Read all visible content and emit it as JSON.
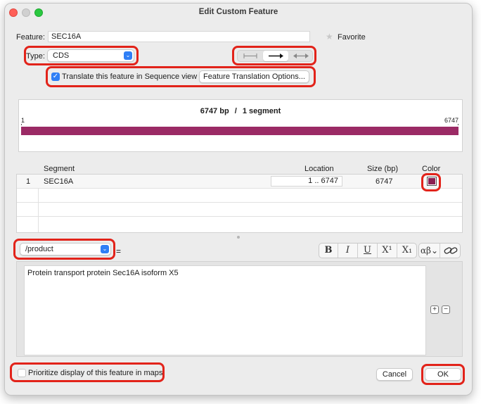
{
  "window": {
    "title": "Edit Custom Feature"
  },
  "feature": {
    "label": "Feature:",
    "name": "SEC16A",
    "favorite_label": "Favorite"
  },
  "type": {
    "label": "Type:",
    "value": "CDS"
  },
  "translate": {
    "checkbox_label": "Translate this feature in Sequence view",
    "checked": true,
    "options_button": "Feature Translation Options..."
  },
  "map": {
    "summary_bp": "6747 bp",
    "summary_sep": "/",
    "summary_seg": "1 segment",
    "start": "1",
    "end": "6747",
    "color": "#9b2a65"
  },
  "segments": {
    "headers": {
      "segment": "Segment",
      "location": "Location",
      "size": "Size (bp)",
      "color": "Color"
    },
    "rows": [
      {
        "index": "1",
        "name": "SEC16A",
        "location": "1  ..  6747",
        "size": "6747",
        "color": "#8a1f52"
      }
    ]
  },
  "qualifier": {
    "name": "/product",
    "equals": "=",
    "value": "Protein transport protein Sec16A isoform X5"
  },
  "format_buttons": {
    "bold": "B",
    "italic": "I",
    "underline": "U",
    "superscript": "X¹",
    "subscript": "X₁",
    "greek": "αβ"
  },
  "prioritize": {
    "label": "Prioritize display of this feature in maps",
    "checked": false
  },
  "buttons": {
    "cancel": "Cancel",
    "ok": "OK"
  },
  "colors": {
    "highlight": "#e2231a",
    "accent": "#2f7ff6",
    "feature_bar": "#9b2a65"
  }
}
